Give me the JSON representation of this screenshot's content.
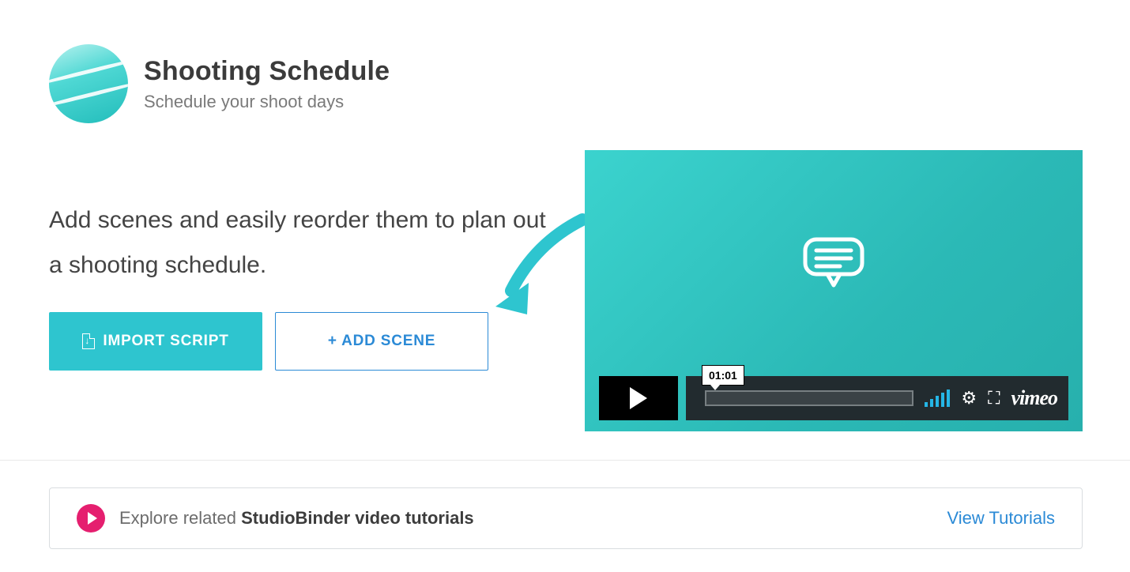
{
  "header": {
    "title": "Shooting Schedule",
    "subtitle": "Schedule your shoot days"
  },
  "main": {
    "description": "Add scenes and easily reorder them to plan out a shooting schedule.",
    "import_label": "IMPORT SCRIPT",
    "add_scene_label": "+ ADD SCENE"
  },
  "video": {
    "time_tooltip": "01:01",
    "provider": "vimeo"
  },
  "banner": {
    "prefix": "Explore related ",
    "strong": "StudioBinder video tutorials",
    "link": "View Tutorials"
  }
}
